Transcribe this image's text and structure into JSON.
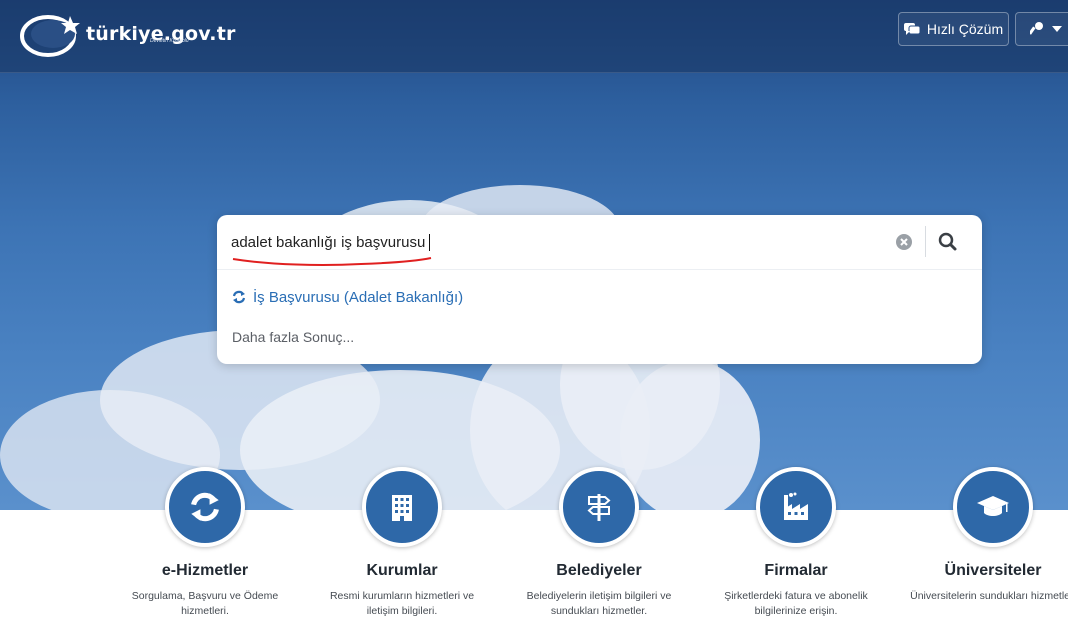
{
  "header": {
    "logo_text": "türkiye.gov.tr",
    "logo_subtext": "Devletin Kısayolu",
    "quick_solution_label": "Hızlı Çözüm",
    "login_icon": "key-icon"
  },
  "search": {
    "value": "adalet bakanlığı iş başvurusu",
    "clear_icon": "clear-icon",
    "search_icon": "search-icon",
    "suggestions": [
      {
        "label": "İş Başvurusu (Adalet Bakanlığı)",
        "icon": "refresh-icon"
      }
    ],
    "more_results_label": "Daha fazla Sonuç..."
  },
  "categories": [
    {
      "title": "e-Hizmetler",
      "description": "Sorgulama, Başvuru ve Ödeme hizmetleri.",
      "icon": "refresh-icon"
    },
    {
      "title": "Kurumlar",
      "description": "Resmi kurumların hizmetleri ve iletişim bilgileri.",
      "icon": "building-icon"
    },
    {
      "title": "Belediyeler",
      "description": "Belediyelerin iletişim bilgileri ve sundukları hizmetler.",
      "icon": "signpost-icon"
    },
    {
      "title": "Firmalar",
      "description": "Şirketlerdeki fatura ve abonelik bilgilerinize erişin.",
      "icon": "factory-icon"
    },
    {
      "title": "Üniversiteler",
      "description": "Üniversitelerin sundukları hizmetler.",
      "icon": "graduation-cap-icon"
    }
  ],
  "colors": {
    "brand_blue": "#2e68a8",
    "link_blue": "#2a6eb5",
    "annotation_red": "#e02020"
  }
}
